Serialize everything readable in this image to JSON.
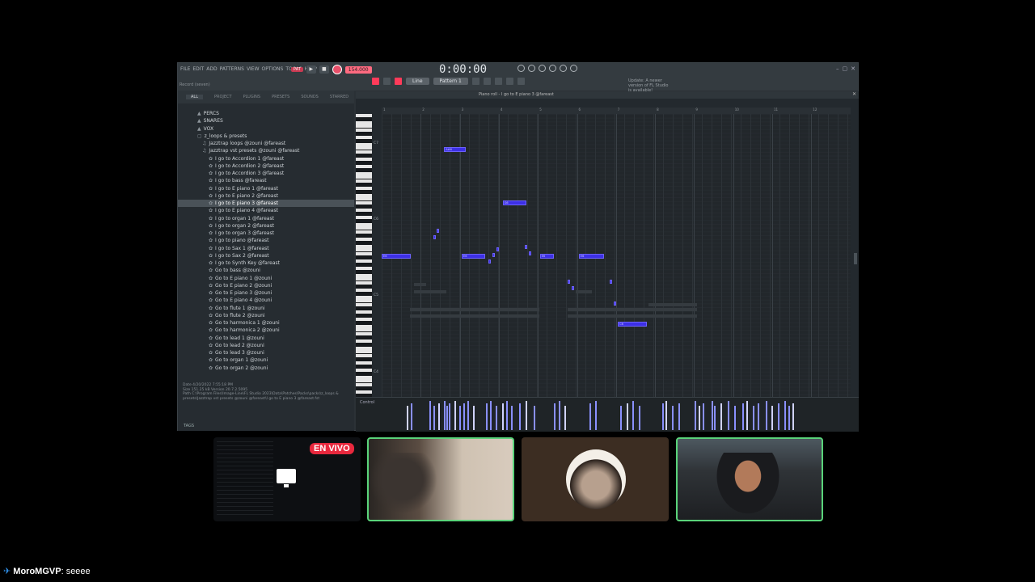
{
  "app": {
    "menu": [
      "FILE",
      "EDIT",
      "ADD",
      "PATTERNS",
      "VIEW",
      "OPTIONS",
      "TOOLS",
      "HELP"
    ],
    "hint": "Record (seven)",
    "pattern_small": "PAT",
    "tempo": "154.000",
    "time": "0:00:00",
    "pattern_select": "Pattern 1",
    "snap": "Line",
    "update_note": "Update: A newer version of FL Studio is available!"
  },
  "browser": {
    "tabs": [
      "ALL",
      "PROJECT",
      "PLUGINS",
      "PRESETS",
      "SOUNDS",
      "STARRED"
    ],
    "items": [
      {
        "label": "PERCS",
        "indent": 24,
        "glyph": "▲"
      },
      {
        "label": "SNARES",
        "indent": 24,
        "glyph": "▲"
      },
      {
        "label": "VOX",
        "indent": 24,
        "glyph": "▲"
      },
      {
        "label": "z_loops & presets",
        "indent": 24,
        "glyph": "▢"
      },
      {
        "label": "Jazztrap loops @zouni @fareast",
        "indent": 30,
        "glyph": "♫"
      },
      {
        "label": "Jazztrap vst presets @zouni @fareast",
        "indent": 30,
        "glyph": "♫"
      },
      {
        "label": "I go to Accordion 1 @fareast",
        "indent": 38,
        "glyph": "✿"
      },
      {
        "label": "I go to Accordion 2 @fareast",
        "indent": 38,
        "glyph": "✿"
      },
      {
        "label": "I go to Accordion 3 @fareast",
        "indent": 38,
        "glyph": "✿"
      },
      {
        "label": "I go to bass @fareast",
        "indent": 38,
        "glyph": "✿"
      },
      {
        "label": "I go to E piano 1 @fareast",
        "indent": 38,
        "glyph": "✿"
      },
      {
        "label": "I go to E piano 2 @fareast",
        "indent": 38,
        "glyph": "✿"
      },
      {
        "label": "I go to E piano 3 @fareast",
        "indent": 38,
        "glyph": "✿",
        "selected": true
      },
      {
        "label": "I go to E piano 4 @fareast",
        "indent": 38,
        "glyph": "✿"
      },
      {
        "label": "I go to organ 1 @fareast",
        "indent": 38,
        "glyph": "✿"
      },
      {
        "label": "I go to organ 2 @fareast",
        "indent": 38,
        "glyph": "✿"
      },
      {
        "label": "I go to organ 3 @fareast",
        "indent": 38,
        "glyph": "✿"
      },
      {
        "label": "I go to piano @fareast",
        "indent": 38,
        "glyph": "✿"
      },
      {
        "label": "I go to Sax 1 @fareast",
        "indent": 38,
        "glyph": "✿"
      },
      {
        "label": "I go to Sax 2 @fareast",
        "indent": 38,
        "glyph": "✿"
      },
      {
        "label": "I go to Synth Key @fareast",
        "indent": 38,
        "glyph": "✿"
      },
      {
        "label": "Go to bass @zouni",
        "indent": 38,
        "glyph": "✿"
      },
      {
        "label": "Go to E piano 1 @zouni",
        "indent": 38,
        "glyph": "✿"
      },
      {
        "label": "Go to E piano 2 @zouni",
        "indent": 38,
        "glyph": "✿"
      },
      {
        "label": "Go to E piano 3 @zouni",
        "indent": 38,
        "glyph": "✿"
      },
      {
        "label": "Go to E piano 4 @zouni",
        "indent": 38,
        "glyph": "✿"
      },
      {
        "label": "Go to flute 1 @zouni",
        "indent": 38,
        "glyph": "✿"
      },
      {
        "label": "Go to flute 2 @zouni",
        "indent": 38,
        "glyph": "✿"
      },
      {
        "label": "Go to harmonica 1 @zouni",
        "indent": 38,
        "glyph": "✿"
      },
      {
        "label": "Go to harmonica 2 @zouni",
        "indent": 38,
        "glyph": "✿"
      },
      {
        "label": "Go to lead 1 @zouni",
        "indent": 38,
        "glyph": "✿"
      },
      {
        "label": "Go to lead 2 @zouni",
        "indent": 38,
        "glyph": "✿"
      },
      {
        "label": "Go to lead 3 @zouni",
        "indent": 38,
        "glyph": "✿"
      },
      {
        "label": "Go to organ 1 @zouni",
        "indent": 38,
        "glyph": "✿"
      },
      {
        "label": "Go to organ 2 @zouni",
        "indent": 38,
        "glyph": "✿"
      }
    ],
    "info_date": "Date   4/20/2022 7:55:18 PM",
    "info_size": "Size    151.25 kB    Version 20.7.2.5095",
    "info_path": "Path   C:\\Program Files\\Image-Line\\FL Studio 2023\\Data\\Patches\\Packs\\packs\\z_loops & presets\\Jazztrap vst presets @zouni @fareast\\I go to E piano 3 @fareast.fst",
    "tags": "TAGS"
  },
  "piano_roll": {
    "title": "Piano roll - I go to E piano 3 @fareast",
    "bar_numbers": [
      "1",
      "2",
      "3",
      "4",
      "5",
      "6",
      "7",
      "8",
      "9",
      "10",
      "11",
      "12"
    ],
    "octave_labels": [
      "C7",
      "C6",
      "C5",
      "C4"
    ],
    "control_label": "Control",
    "notes": [
      {
        "label": "A#6",
        "bar": 2.6,
        "length": 0.55,
        "key": 44
      },
      {
        "label": "G6",
        "bar": 4.1,
        "length": 0.6,
        "key": 30
      },
      {
        "label": "E6",
        "bar": 1.0,
        "length": 0.75,
        "key": 16
      },
      {
        "label": "E6",
        "bar": 3.05,
        "length": 0.6,
        "key": 16
      },
      {
        "label": "E6",
        "bar": 5.05,
        "length": 0.35,
        "key": 16
      },
      {
        "label": "E6",
        "bar": 6.05,
        "length": 0.65,
        "key": 16
      },
      {
        "label": "C6",
        "bar": 7.05,
        "length": 0.75,
        "key": -2
      }
    ]
  },
  "stream": {
    "live_badge": "EN VIVO",
    "chat_user": "MoroMGVP",
    "chat_message": "seeee"
  }
}
